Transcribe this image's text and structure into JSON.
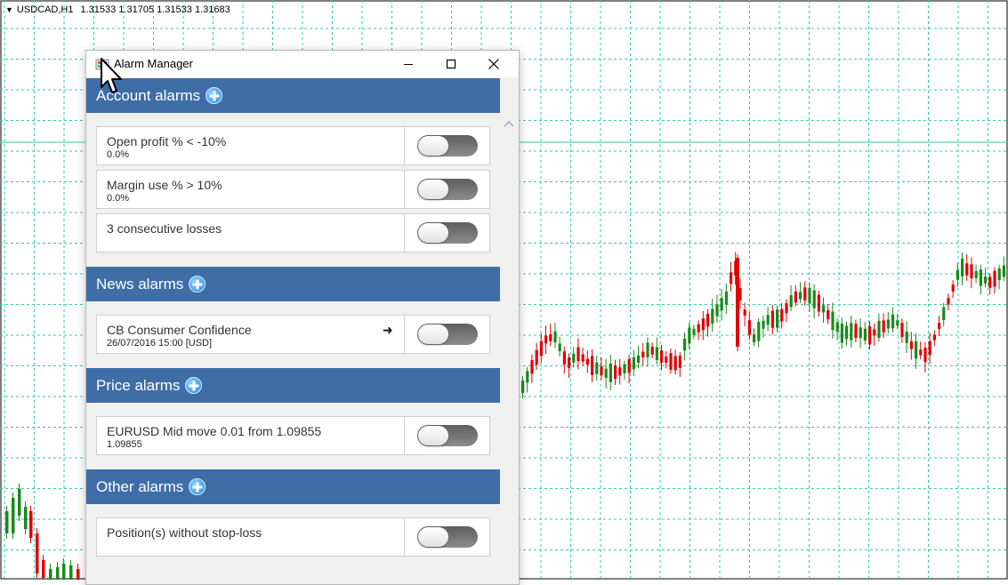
{
  "chart": {
    "symbol": "USDCAD,H1",
    "prices": "1.31533 1.31705 1.31533 1.31683",
    "grid_color": "#33ccaa",
    "bull_color": "#1a8a1a",
    "bear_color": "#e00000",
    "icons": [
      "chart-menu-triangle-icon"
    ]
  },
  "window": {
    "title": "Alarm Manager",
    "icons": [
      "alarm-manager-app-icon",
      "minimize-icon",
      "maximize-icon",
      "close-icon",
      "scroll-up-icon",
      "mouse-cursor-icon"
    ]
  },
  "sections": [
    {
      "key": "account",
      "title": "Account alarms",
      "alarms": [
        {
          "title": "Open profit % < -10%",
          "sub": "0.0%"
        },
        {
          "title": "Margin use % > 10%",
          "sub": "0.0%"
        },
        {
          "title": "3 consecutive losses",
          "sub": ""
        }
      ]
    },
    {
      "key": "news",
      "title": "News alarms",
      "alarms": [
        {
          "title": "CB Consumer Confidence",
          "sub": "26/07/2016 15:00 [USD]",
          "arrow": "➜"
        }
      ]
    },
    {
      "key": "price",
      "title": "Price alarms",
      "alarms": [
        {
          "title": "EURUSD Mid move 0.01 from 1.09855",
          "sub": "1.09855"
        }
      ]
    },
    {
      "key": "other",
      "title": "Other alarms",
      "alarms": [
        {
          "title": "Position(s) without stop-loss",
          "sub": ""
        }
      ]
    }
  ],
  "colors": {
    "section_header_bg": "#3f6ea6",
    "toggle_off": "#707070"
  }
}
